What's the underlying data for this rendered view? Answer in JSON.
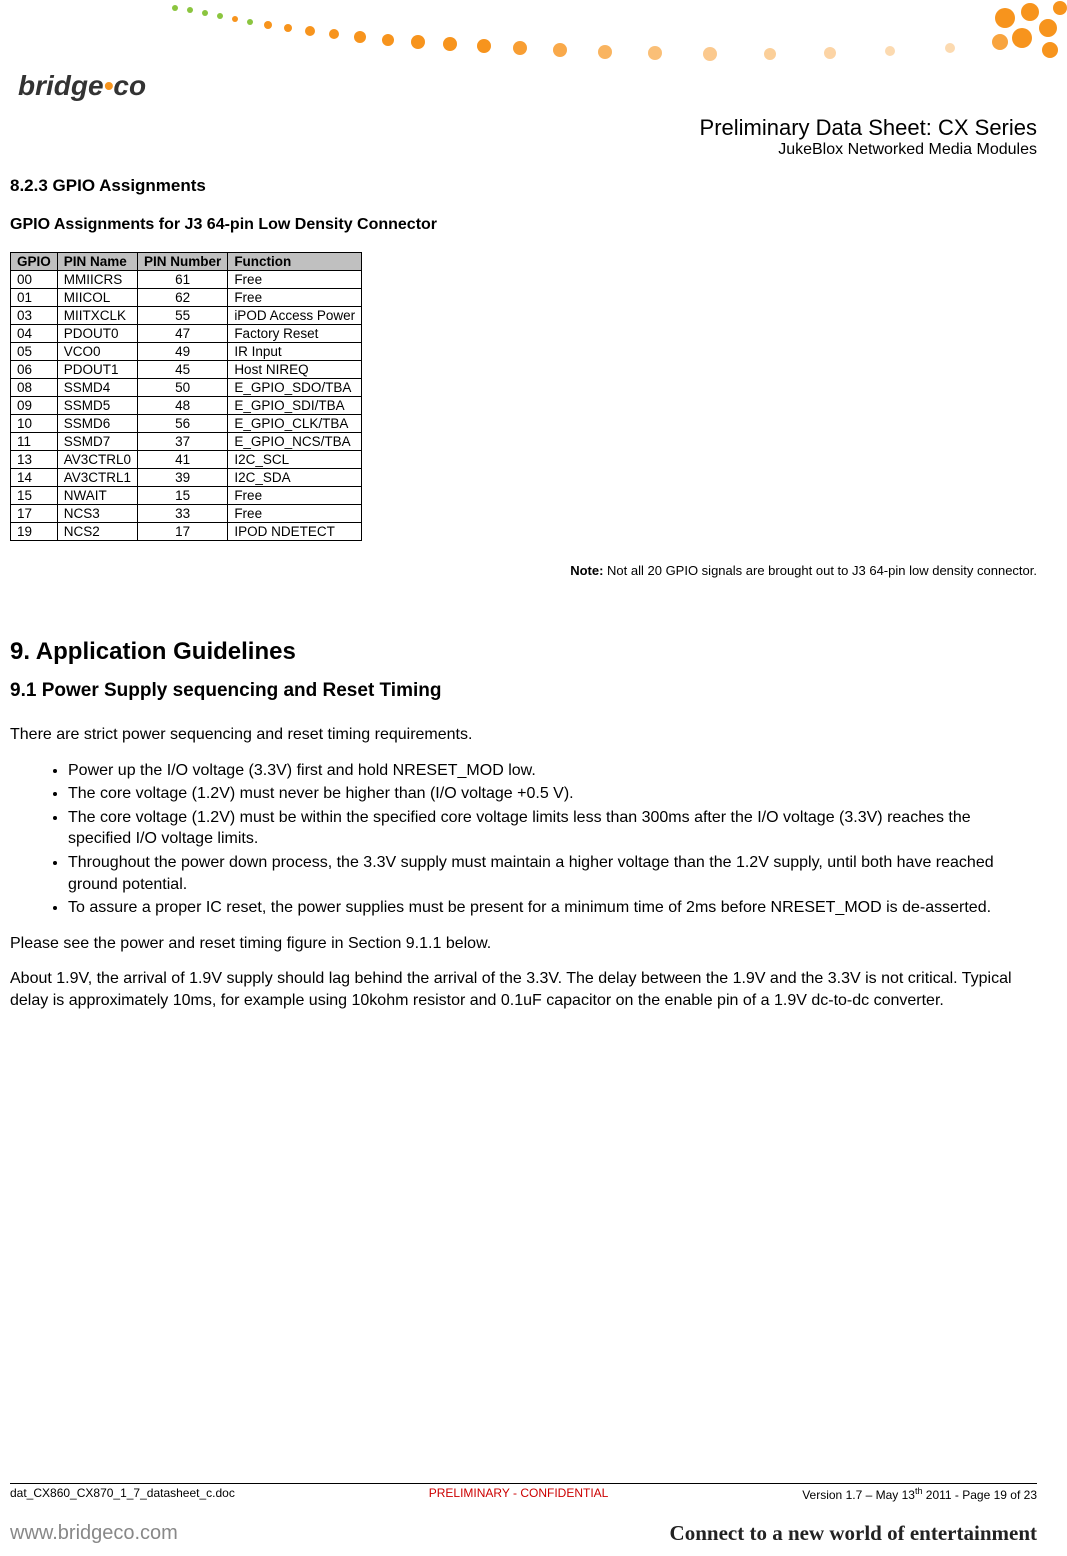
{
  "header": {
    "logo_text_a": "bridge",
    "logo_text_b": "co",
    "title": "Preliminary Data Sheet: CX Series",
    "subtitle": "JukeBlox Networked Media Modules"
  },
  "section_823": "8.2.3 GPIO Assignments",
  "table_title": "GPIO Assignments for J3 64-pin Low Density Connector",
  "table": {
    "headers": [
      "GPIO",
      "PIN Name",
      "PIN Number",
      "Function"
    ],
    "rows": [
      [
        "00",
        "MMIICRS",
        "61",
        "Free"
      ],
      [
        "01",
        "MIICOL",
        "62",
        "Free"
      ],
      [
        "03",
        "MIITXCLK",
        "55",
        "iPOD Access Power"
      ],
      [
        "04",
        "PDOUT0",
        "47",
        "Factory Reset"
      ],
      [
        "05",
        "VCO0",
        "49",
        "IR Input"
      ],
      [
        "06",
        "PDOUT1",
        "45",
        "Host NIREQ"
      ],
      [
        "08",
        "SSMD4",
        "50",
        "E_GPIO_SDO/TBA"
      ],
      [
        "09",
        "SSMD5",
        "48",
        "E_GPIO_SDI/TBA"
      ],
      [
        "10",
        "SSMD6",
        "56",
        "E_GPIO_CLK/TBA"
      ],
      [
        "11",
        "SSMD7",
        "37",
        "E_GPIO_NCS/TBA"
      ],
      [
        "13",
        "AV3CTRL0",
        "41",
        "I2C_SCL"
      ],
      [
        "14",
        "AV3CTRL1",
        "39",
        "I2C_SDA"
      ],
      [
        "15",
        "NWAIT",
        "15",
        "Free"
      ],
      [
        "17",
        "NCS3",
        "33",
        "Free"
      ],
      [
        "19",
        "NCS2",
        "17",
        "IPOD NDETECT"
      ]
    ]
  },
  "note_label": "Note:",
  "note_text": " Not all 20 GPIO signals are brought out to J3 64-pin low density connector.",
  "section_9": "9. Application Guidelines",
  "section_91": "9.1 Power Supply sequencing and Reset Timing",
  "para1": "There are strict power sequencing and reset timing requirements.",
  "bullets": [
    "Power up the I/O voltage (3.3V) first and hold NRESET_MOD low.",
    "The core voltage (1.2V) must never be higher than (I/O voltage +0.5 V).",
    "The core voltage (1.2V) must be within the specified core voltage limits less than 300ms after the I/O voltage (3.3V) reaches the specified I/O voltage limits.",
    "Throughout the power down process, the 3.3V supply must maintain a higher voltage than the 1.2V supply, until both have reached ground potential.",
    "To assure a proper IC reset, the power supplies must be present for a minimum time of 2ms before NRESET_MOD is de-asserted."
  ],
  "para2": "Please see the power and reset timing figure in Section 9.1.1 below.",
  "para3": "About 1.9V, the arrival of 1.9V supply should lag behind the arrival of the 3.3V. The delay between the 1.9V and the 3.3V is not critical. Typical delay is approximately 10ms, for example using 10kohm resistor and 0.1uF capacitor on the enable pin of a 1.9V dc-to-dc converter.",
  "footer": {
    "left": "dat_CX860_CX870_1_7_datasheet_c.doc",
    "mid": "PRELIMINARY - CONFIDENTIAL",
    "right_a": "Version 1.7 – May 13",
    "right_sup": "th",
    "right_b": " 2011 - Page 19 of 23"
  },
  "bottom": {
    "www": "www.bridgeco.com",
    "tagline": "Connect to a new world of entertainment"
  }
}
